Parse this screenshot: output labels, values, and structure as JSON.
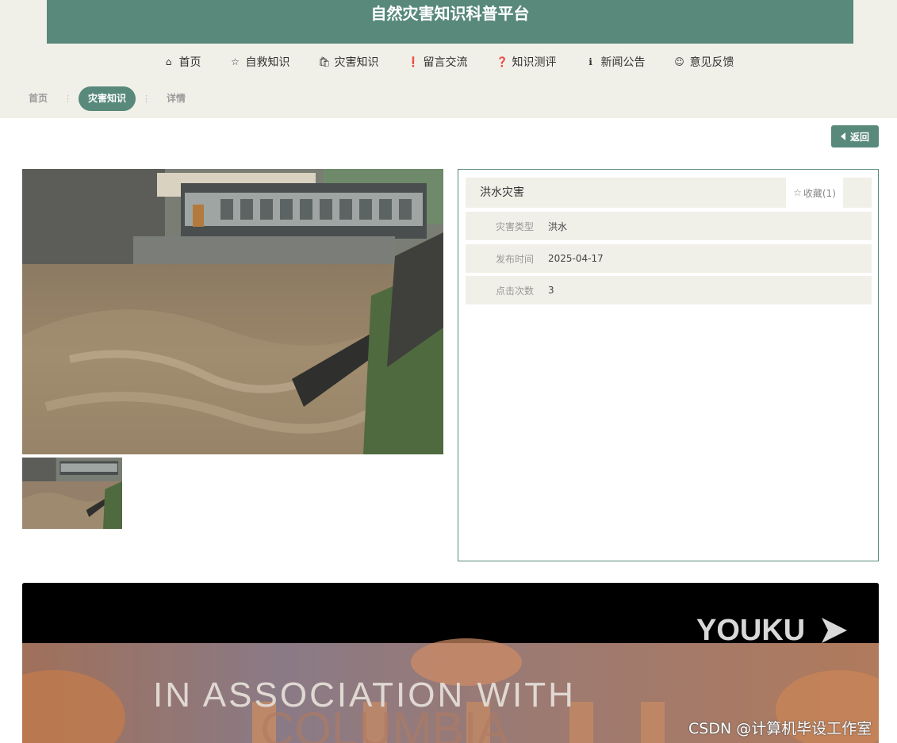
{
  "header": {
    "title": "自然灾害知识科普平台"
  },
  "nav": [
    {
      "icon": "home-icon",
      "glyph": "⌂",
      "label": "首页"
    },
    {
      "icon": "star-icon",
      "glyph": "☆",
      "label": "自救知识"
    },
    {
      "icon": "bag-icon",
      "glyph": "⛉",
      "label": "灾害知识"
    },
    {
      "icon": "alert-icon",
      "glyph": "●",
      "label": "留言交流"
    },
    {
      "icon": "question-icon",
      "glyph": "●",
      "label": "知识测评"
    },
    {
      "icon": "info-icon",
      "glyph": "●",
      "label": "新闻公告"
    },
    {
      "icon": "feedback-icon",
      "glyph": "◎",
      "label": "意见反馈"
    }
  ],
  "breadcrumb": {
    "home": "首页",
    "current": "灾害知识",
    "detail": "详情",
    "sep": "⋮"
  },
  "back_button": {
    "label": "返回"
  },
  "detail": {
    "title": "洪水灾害",
    "favorite_label": "收藏(1)",
    "rows": [
      {
        "label": "灾害类型",
        "value": "洪水"
      },
      {
        "label": "发布时间",
        "value": "2025-04-17"
      },
      {
        "label": "点击次数",
        "value": "3"
      }
    ]
  },
  "video": {
    "logo": "YOUKU",
    "caption": "IN ASSOCIATION WITH",
    "overlay_word": "COLUMBIA"
  },
  "watermark": "CSDN @计算机毕设工作室",
  "colors": {
    "brand": "#58897b",
    "band": "#f1f0e8"
  }
}
